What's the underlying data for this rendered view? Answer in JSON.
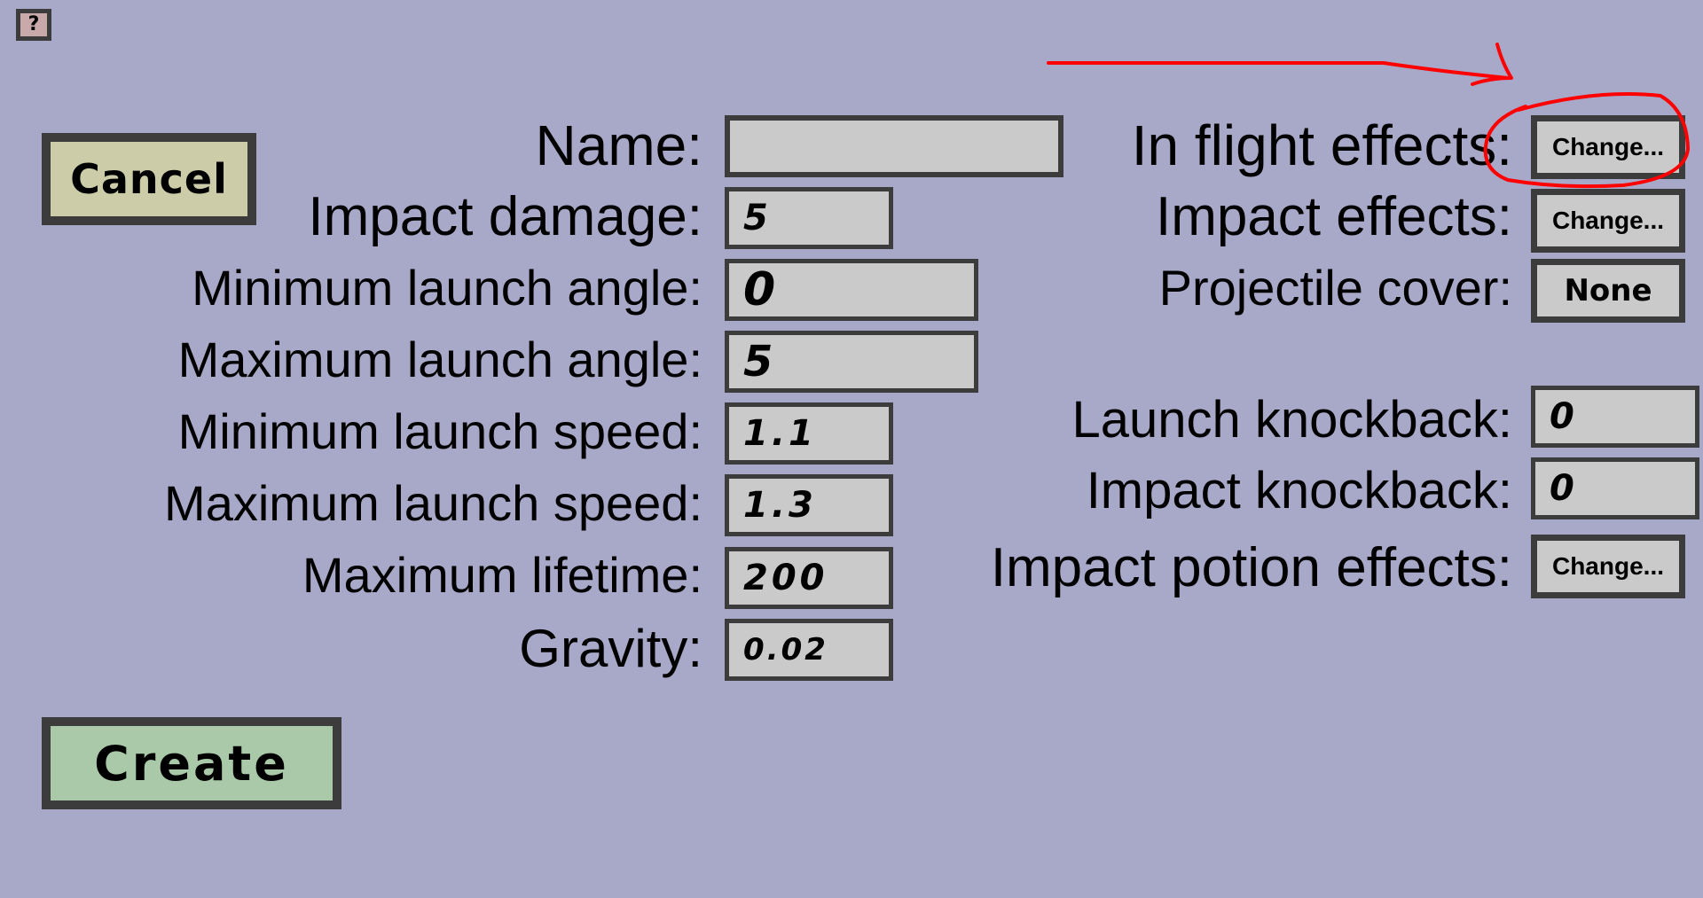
{
  "help": {
    "label": "?"
  },
  "buttons": {
    "cancel": "Cancel",
    "create": "Create"
  },
  "left_fields": {
    "name": {
      "label": "Name:",
      "value": ""
    },
    "impact_damage": {
      "label": "Impact damage:",
      "value": "5"
    },
    "min_launch_angle": {
      "label": "Minimum launch angle:",
      "value": "0"
    },
    "max_launch_angle": {
      "label": "Maximum launch angle:",
      "value": "5"
    },
    "min_launch_speed": {
      "label": "Minimum launch speed:",
      "value": "1.1"
    },
    "max_launch_speed": {
      "label": "Maximum launch speed:",
      "value": "1.3"
    },
    "max_lifetime": {
      "label": "Maximum lifetime:",
      "value": "200"
    },
    "gravity": {
      "label": "Gravity:",
      "value": "0.02"
    }
  },
  "right_fields": {
    "in_flight_effects": {
      "label": "In flight effects:",
      "button": "Change..."
    },
    "impact_effects": {
      "label": "Impact effects:",
      "button": "Change..."
    },
    "projectile_cover": {
      "label": "Projectile cover:",
      "button": "None"
    },
    "launch_knockback": {
      "label": "Launch knockback:",
      "value": "0"
    },
    "impact_knockback": {
      "label": "Impact knockback:",
      "value": "0"
    },
    "impact_potion_effects": {
      "label": "Impact potion effects:",
      "button": "Change..."
    }
  },
  "colors": {
    "background": "#a8a8c8",
    "cancel_button": "#cccca9",
    "create_button": "#a9c9a9",
    "field": "#cacaca",
    "border": "#3c3c3c",
    "annotation": "#ff0000"
  }
}
